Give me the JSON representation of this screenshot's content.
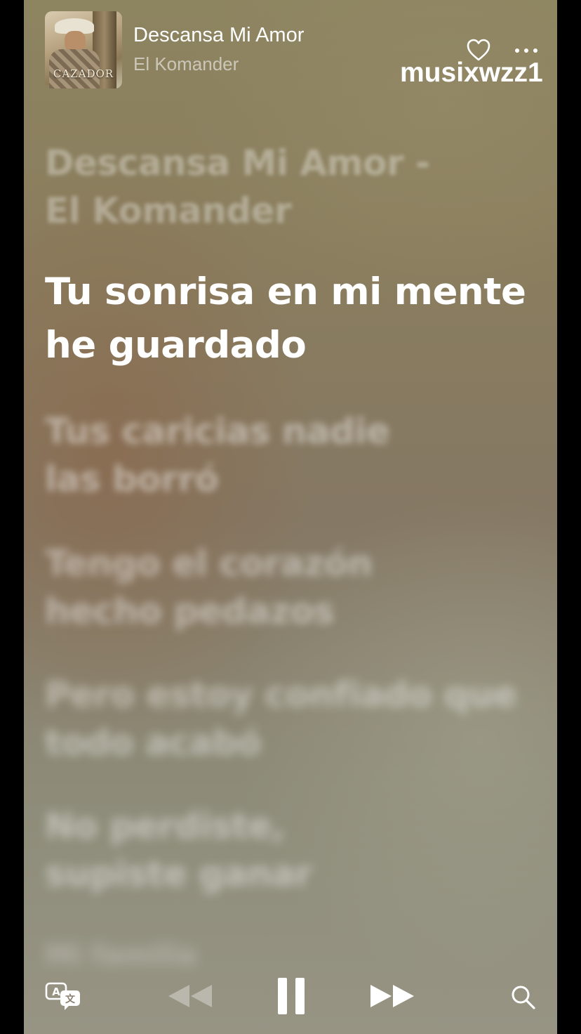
{
  "now_playing": {
    "album_art_text": "CAZADOR",
    "title": "Descansa Mi Amor",
    "artist": "El Komander"
  },
  "header_icons": {
    "favorite": "heart-icon",
    "more": "ellipsis-icon"
  },
  "watermark": "musixwzz1",
  "lyrics": {
    "heading": "Descansa Mi Amor -\nEl Komander",
    "current": "Tu sonrisa en mi mente\nhe guardado",
    "upcoming": [
      "Tus caricias nadie\nlas borró",
      "Tengo el corazón\nhecho pedazos",
      "Pero estoy confiado que\ntodo acabó",
      "No perdiste,\nsupiste ganar",
      "Mi familia"
    ]
  },
  "controls": {
    "translate": "translate-icon",
    "rewind": "rewind-icon",
    "pause": "pause-icon",
    "forward": "fast-forward-icon",
    "search": "search-icon"
  },
  "colors": {
    "active_lyric": "#ffffff",
    "inactive_lyric": "rgba(255,255,255,0.45)",
    "background": "#8a7d5e"
  }
}
